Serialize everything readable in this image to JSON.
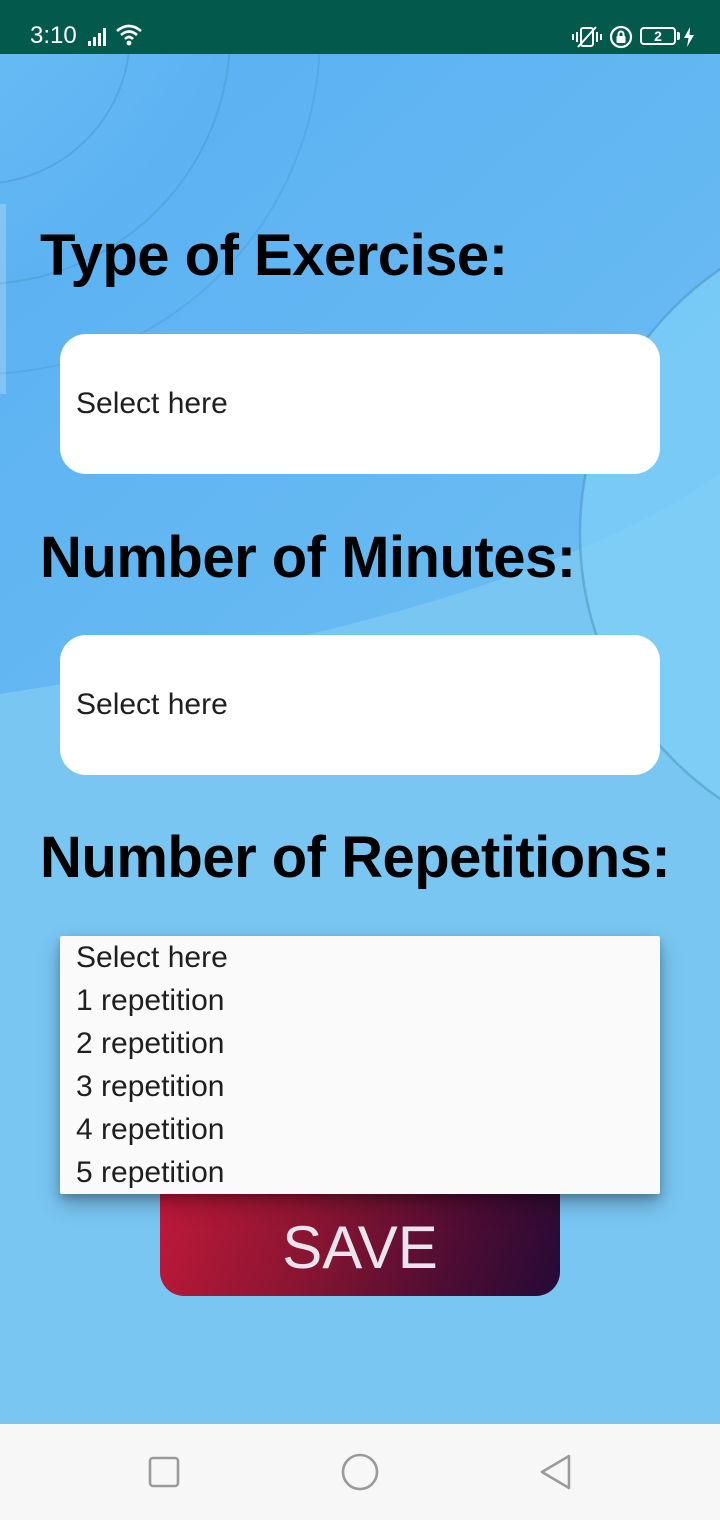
{
  "status_bar": {
    "time": "3:10",
    "battery_level": "2",
    "icons": [
      "signal-icon",
      "wifi-icon",
      "vibrate-icon",
      "lock-icon",
      "battery-icon",
      "charging-bolt-icon"
    ]
  },
  "form": {
    "exercise": {
      "label": "Type of Exercise:",
      "selected": "Select here"
    },
    "minutes": {
      "label": "Number of Minutes:",
      "selected": "Select here"
    },
    "repetitions": {
      "label": "Number of Repetitions:",
      "options": [
        "Select here",
        "1 repetition",
        "2 repetition",
        "3 repetition",
        "4 repetition",
        "5 repetition"
      ]
    },
    "save_label": "SAVE"
  },
  "nav_bar": {
    "icons": [
      "recents-square-icon",
      "home-circle-icon",
      "back-triangle-icon"
    ]
  },
  "colors": {
    "status_bar": "#035a4c",
    "background": "#78c5f2",
    "save_gradient_start": "#c4193a",
    "save_gradient_end": "#250a36"
  }
}
